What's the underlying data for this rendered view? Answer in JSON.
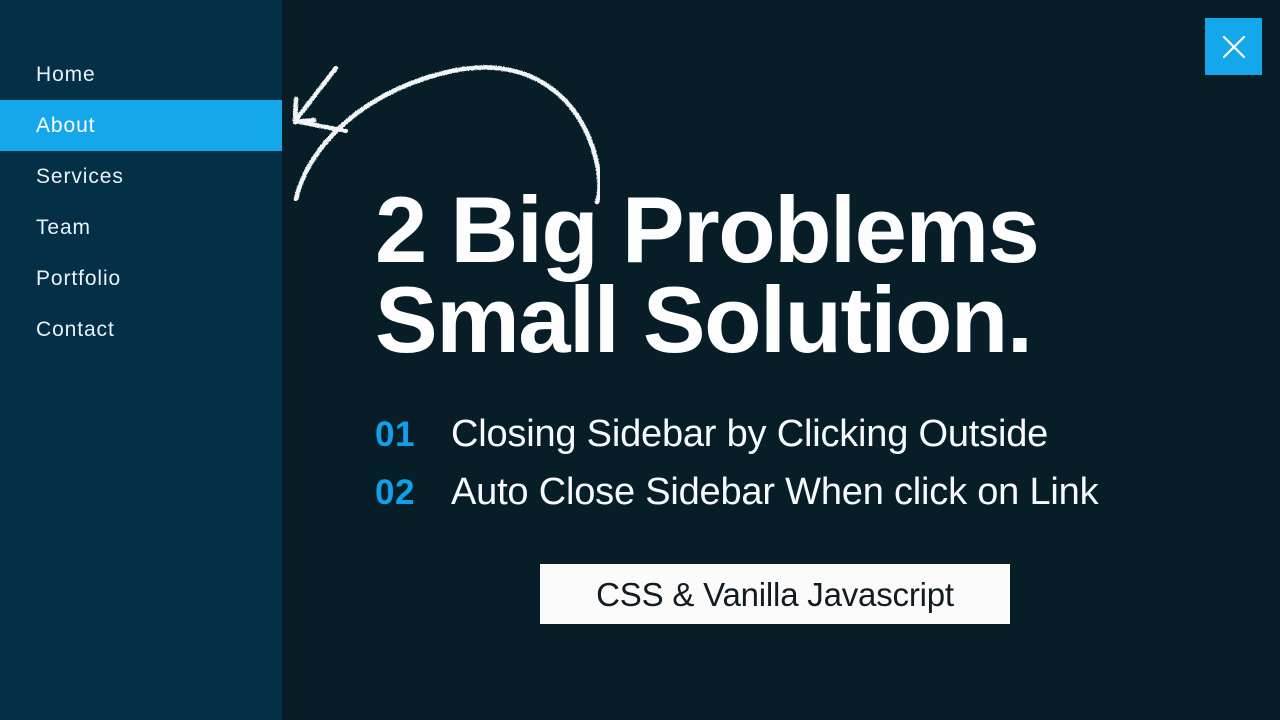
{
  "window": {
    "background_color": "#071e28",
    "accent_color": "#14A7EC"
  },
  "sidebar": {
    "background_color": "#033047",
    "active_item_color": "#14A7EC",
    "items": [
      {
        "label": "Home",
        "active": false
      },
      {
        "label": "About",
        "active": true
      },
      {
        "label": "Services",
        "active": false
      },
      {
        "label": "Team",
        "active": false
      },
      {
        "label": "Portfolio",
        "active": false
      },
      {
        "label": "Contact",
        "active": false
      }
    ]
  },
  "close_button": {
    "icon": "close-x-icon",
    "label": "Close sidebar",
    "color": "#14A7EC"
  },
  "annotation": {
    "icon": "curved-arrow-icon",
    "direction": "points-left-to-sidebar"
  },
  "main": {
    "headline": {
      "line1": "2 Big Problems",
      "line2": "Small Solution."
    },
    "problems": [
      {
        "number": "01",
        "text": "Closing Sidebar by Clicking Outside"
      },
      {
        "number": "02",
        "text": "Auto Close Sidebar When click on Link"
      }
    ],
    "badge": {
      "text": "CSS & Vanilla Javascript"
    }
  }
}
